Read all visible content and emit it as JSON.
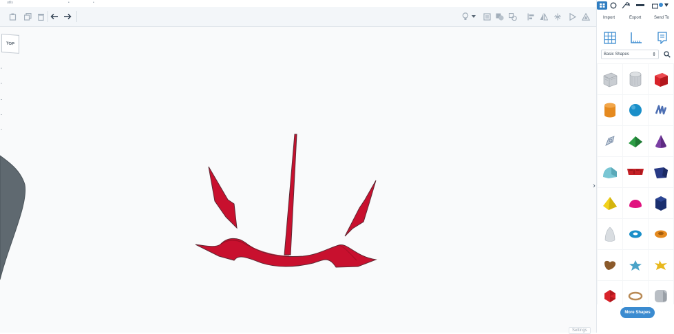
{
  "window": {
    "title_fragment": "utils"
  },
  "toolbar": {
    "tools": [
      {
        "icon": "paste-icon"
      },
      {
        "icon": "copy-icon"
      },
      {
        "icon": "duplicate-icon"
      },
      {
        "icon": "delete-icon"
      },
      {
        "icon": "undo-icon"
      },
      {
        "icon": "redo-icon"
      }
    ],
    "right_tools": [
      {
        "icon": "light-bulb-icon"
      },
      {
        "icon": "dropdown-icon"
      },
      {
        "icon": "note-icon"
      },
      {
        "icon": "group-icon"
      },
      {
        "icon": "ungroup-icon"
      },
      {
        "icon": "align-icon"
      },
      {
        "icon": "mirror-icon"
      },
      {
        "icon": "cruise-icon"
      },
      {
        "icon": "play-icon"
      },
      {
        "icon": "workplane-icon"
      }
    ]
  },
  "viewcube": {
    "label": "TOP"
  },
  "panel": {
    "actions": {
      "import": "Import",
      "export": "Export",
      "send_to": "Send To"
    },
    "shape_library": {
      "selected": "Basic Shapes"
    },
    "shapes": [
      {
        "name": "Box Hole",
        "color": "#b9bec4"
      },
      {
        "name": "Cylinder Hole",
        "color": "#c0c4c8"
      },
      {
        "name": "Box",
        "color": "#d8232a"
      },
      {
        "name": "Cylinder",
        "color": "#e58a1f"
      },
      {
        "name": "Sphere",
        "color": "#1a8fc9"
      },
      {
        "name": "Scribble",
        "color": "#4d6fb3"
      },
      {
        "name": "Text Hole",
        "color": "#a9b8cc"
      },
      {
        "name": "Roof",
        "color": "#2d9e46"
      },
      {
        "name": "Cone",
        "color": "#7a3fa3"
      },
      {
        "name": "Round Roof",
        "color": "#79c6d4"
      },
      {
        "name": "Text",
        "color": "#c42026"
      },
      {
        "name": "Wedge",
        "color": "#283a85"
      },
      {
        "name": "Pyramid",
        "color": "#f2d11c"
      },
      {
        "name": "Half Sphere",
        "color": "#e1137f"
      },
      {
        "name": "Polygon",
        "color": "#1a2f6e"
      },
      {
        "name": "Paraboloid",
        "color": "#d9dde1"
      },
      {
        "name": "Torus",
        "color": "#1a8fc9"
      },
      {
        "name": "Tube",
        "color": "#e58a1f"
      },
      {
        "name": "Heart",
        "color": "#8b5a2b"
      },
      {
        "name": "Star",
        "color": "#4aa3c8"
      },
      {
        "name": "Star Gold",
        "color": "#e8b81e"
      },
      {
        "name": "Icosahedron",
        "color": "#d8232a"
      },
      {
        "name": "Ring",
        "color": "#b98a55"
      },
      {
        "name": "Rounded Box",
        "color": "#b9bec4"
      }
    ],
    "more_shapes": "More Shapes"
  },
  "settings": {
    "label": "Settings"
  },
  "model": {
    "color": "#c8102e",
    "outline": "#6b2a36"
  }
}
